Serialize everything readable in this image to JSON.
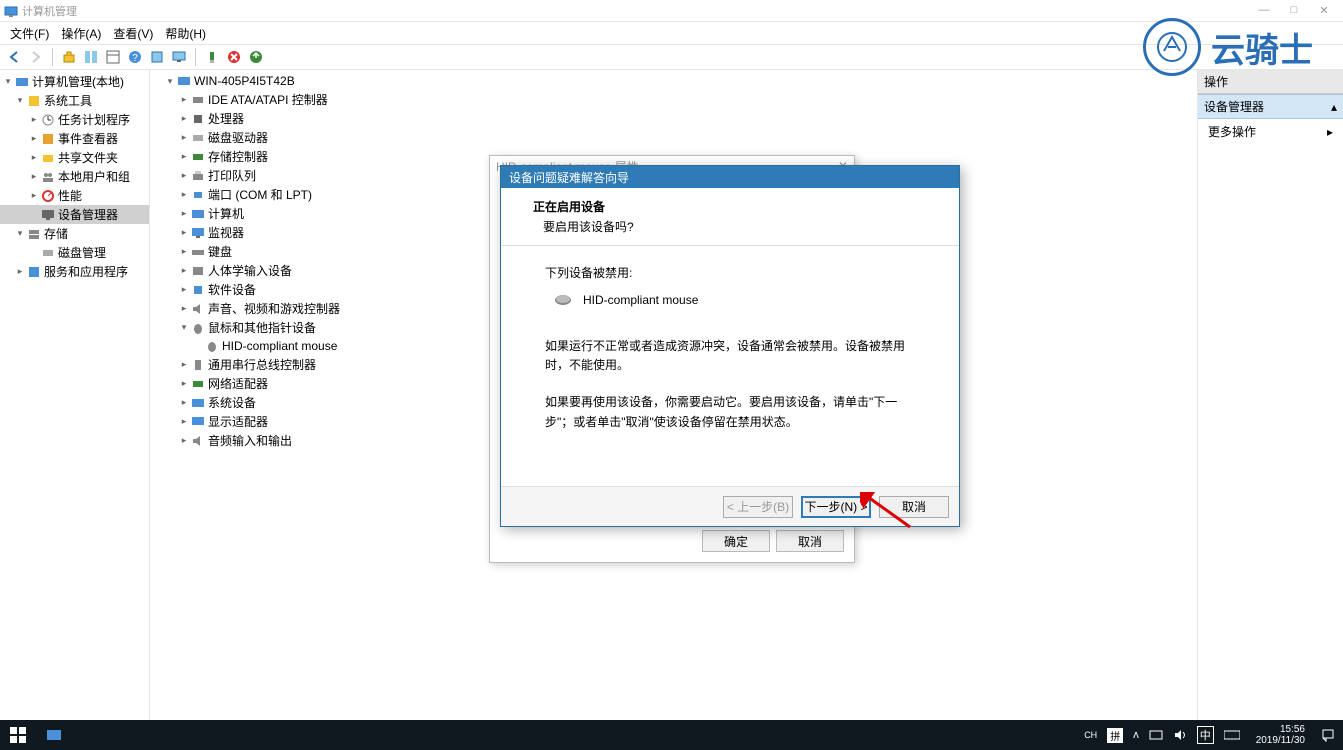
{
  "window": {
    "title": "计算机管理",
    "controls": {
      "min": "—",
      "max": "□",
      "close": "✕"
    }
  },
  "menu": {
    "file": "文件(F)",
    "action": "操作(A)",
    "view": "查看(V)",
    "help": "帮助(H)"
  },
  "leftTree": {
    "root": "计算机管理(本地)",
    "systemTools": "系统工具",
    "taskScheduler": "任务计划程序",
    "eventViewer": "事件查看器",
    "sharedFolders": "共享文件夹",
    "localUsers": "本地用户和组",
    "performance": "性能",
    "deviceManager": "设备管理器",
    "storage": "存储",
    "diskMgmt": "磁盘管理",
    "services": "服务和应用程序"
  },
  "midTree": {
    "root": "WIN-405P4I5T42B",
    "ide": "IDE ATA/ATAPI 控制器",
    "processor": "处理器",
    "diskDrive": "磁盘驱动器",
    "storageCtrl": "存储控制器",
    "printQueue": "打印队列",
    "port": "端口 (COM 和 LPT)",
    "computer": "计算机",
    "monitor": "监视器",
    "keyboard": "键盘",
    "hid": "人体学输入设备",
    "software": "软件设备",
    "sound": "声音、视频和游戏控制器",
    "mouse": "鼠标和其他指针设备",
    "hidMouse": "HID-compliant mouse",
    "usb": "通用串行总线控制器",
    "network": "网络适配器",
    "system": "系统设备",
    "display": "显示适配器",
    "audioIO": "音频输入和输出"
  },
  "rightPanel": {
    "header": "操作",
    "section": "设备管理器",
    "more": "更多操作"
  },
  "propsDialog": {
    "title": "HID-compliant mouse 属性",
    "ok": "确定",
    "cancel": "取消"
  },
  "wizard": {
    "title": "设备问题疑难解答向导",
    "heading": "正在启用设备",
    "subheading": "要启用该设备吗?",
    "disabledLabel": "下列设备被禁用:",
    "deviceName": "HID-compliant mouse",
    "info1": "如果运行不正常或者造成资源冲突，设备通常会被禁用。设备被禁用时，不能使用。",
    "info2": "如果要再使用该设备，你需要启动它。要启用该设备，请单击\"下一步\"；或者单击\"取消\"使该设备停留在禁用状态。",
    "back": "< 上一步(B)",
    "next": "下一步(N) >",
    "cancel": "取消"
  },
  "watermark": {
    "text": "云骑士"
  },
  "taskbar": {
    "ime": "CH",
    "ime2": "拼",
    "ime3": "中",
    "time": "15:56",
    "date": "2019/11/30"
  }
}
